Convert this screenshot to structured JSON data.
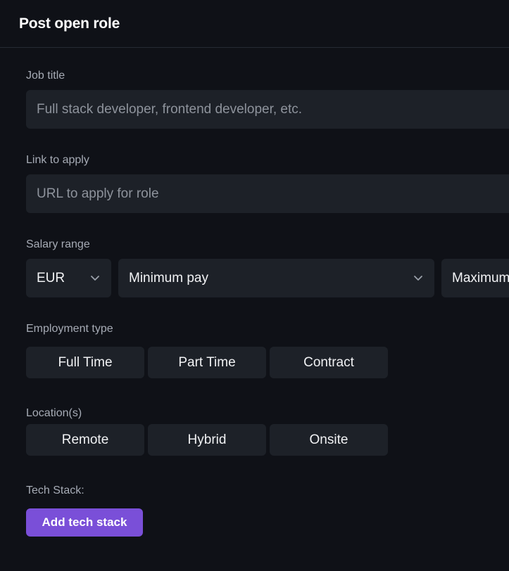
{
  "header": {
    "title": "Post open role"
  },
  "job_title": {
    "label": "Job title",
    "placeholder": "Full stack developer, frontend developer, etc.",
    "value": ""
  },
  "apply_link": {
    "label": "Link to apply",
    "placeholder": "URL to apply for role",
    "value": ""
  },
  "salary": {
    "label": "Salary range",
    "currency": "EUR",
    "minimum": "Minimum pay",
    "maximum": "Maximum pay"
  },
  "employment_type": {
    "label": "Employment type",
    "options": [
      "Full Time",
      "Part Time",
      "Contract"
    ]
  },
  "locations": {
    "label": "Location(s)",
    "options": [
      "Remote",
      "Hybrid",
      "Onsite"
    ]
  },
  "tech_stack": {
    "label": "Tech Stack:",
    "button": "Add tech stack"
  },
  "colors": {
    "background": "#0f1117",
    "input_bg": "#1d2128",
    "accent": "#7a4fd8"
  },
  "icons": {
    "dropdown": "chevron-down-icon"
  }
}
